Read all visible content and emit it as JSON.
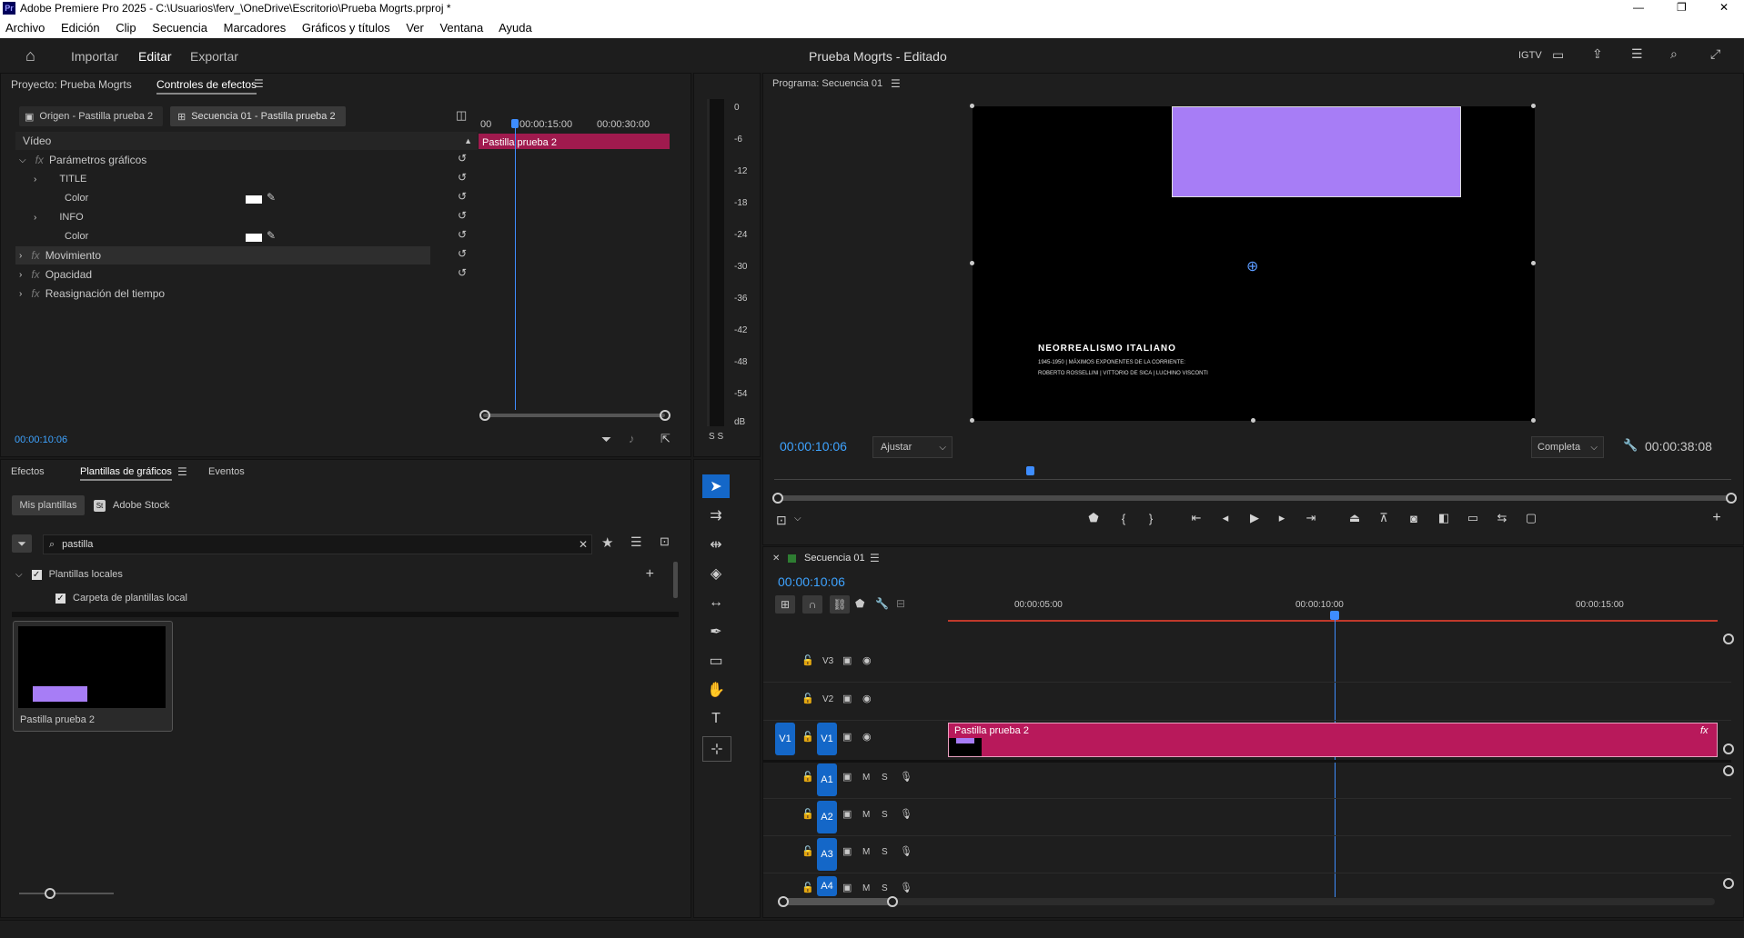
{
  "window": {
    "title": "Adobe Premiere Pro 2025 - C:\\Usuarios\\ferv_\\OneDrive\\Escritorio\\Prueba Mogrts.prproj *",
    "app_badge": "Pr",
    "minimize": "—",
    "maximize": "❐",
    "close": "✕"
  },
  "menu": [
    "Archivo",
    "Edición",
    "Clip",
    "Secuencia",
    "Marcadores",
    "Gráficos y títulos",
    "Ver",
    "Ventana",
    "Ayuda"
  ],
  "appbar": {
    "tabs": [
      "Importar",
      "Editar",
      "Exportar"
    ],
    "active_tab": "Editar",
    "project_title": "Prueba Mogrts - Editado",
    "igtv": "IGTV"
  },
  "effect_controls": {
    "project_tab": "Proyecto: Prueba Mogrts",
    "active_tab": "Controles de efectos",
    "source_tab": "Origen - Pastilla prueba 2",
    "sequence_tab": "Secuencia 01 - Pastilla prueba 2",
    "section": "Vídeo",
    "params": {
      "graphic": "Parámetros gráficos",
      "title": "TITLE",
      "color1": "Color",
      "info": "INFO",
      "color2": "Color",
      "movement": "Movimiento",
      "opacity": "Opacidad",
      "time_remap": "Reasignación del tiempo"
    },
    "ruler": [
      "00",
      "00:00:15:00",
      "00:00:30:00"
    ],
    "clip_name": "Pastilla prueba 2",
    "timecode": "00:00:10:06",
    "fx": "fx"
  },
  "meter": {
    "labels": [
      "0",
      "-6",
      "-12",
      "-18",
      "-24",
      "-30",
      "-36",
      "-42",
      "-48",
      "-54",
      "dB"
    ],
    "ss": "S S"
  },
  "program": {
    "title": "Programa: Secuencia 01",
    "overlay_title": "NEORREALISMO ITALIANO",
    "overlay_line1": "1945-1950 | MÁXIMOS EXPONENTES DE LA CORRIENTE:",
    "overlay_line2": "ROBERTO ROSSELLINI | VITTORIO DE SICA | LUCHINO VISCONTI",
    "timecode": "00:00:10:06",
    "fit": "Ajustar",
    "quality": "Completa",
    "duration": "00:00:38:08",
    "purple": "#a77df6"
  },
  "templates": {
    "tabs": [
      "Efectos",
      "Plantillas de gráficos",
      "Eventos"
    ],
    "active_tab": "Plantillas de gráficos",
    "my_templates": "Mis plantillas",
    "adobe_stock": "Adobe Stock",
    "search_value": "pastilla",
    "local_templates": "Plantillas locales",
    "local_folder": "Carpeta de plantillas local",
    "item_name": "Pastilla prueba 2"
  },
  "timeline": {
    "sequence": "Secuencia 01",
    "timecode": "00:00:10:06",
    "ruler": [
      "00:00:05:00",
      "00:00:10:00",
      "00:00:15:00"
    ],
    "video_tracks": [
      "V3",
      "V2",
      "V1"
    ],
    "audio_tracks": [
      "A1",
      "A2",
      "A3",
      "A4"
    ],
    "source_patch": "V1",
    "mute": "M",
    "solo": "S",
    "clip_name": "Pastilla prueba 2",
    "clip_color": "#b8195b",
    "fx": "fx"
  }
}
